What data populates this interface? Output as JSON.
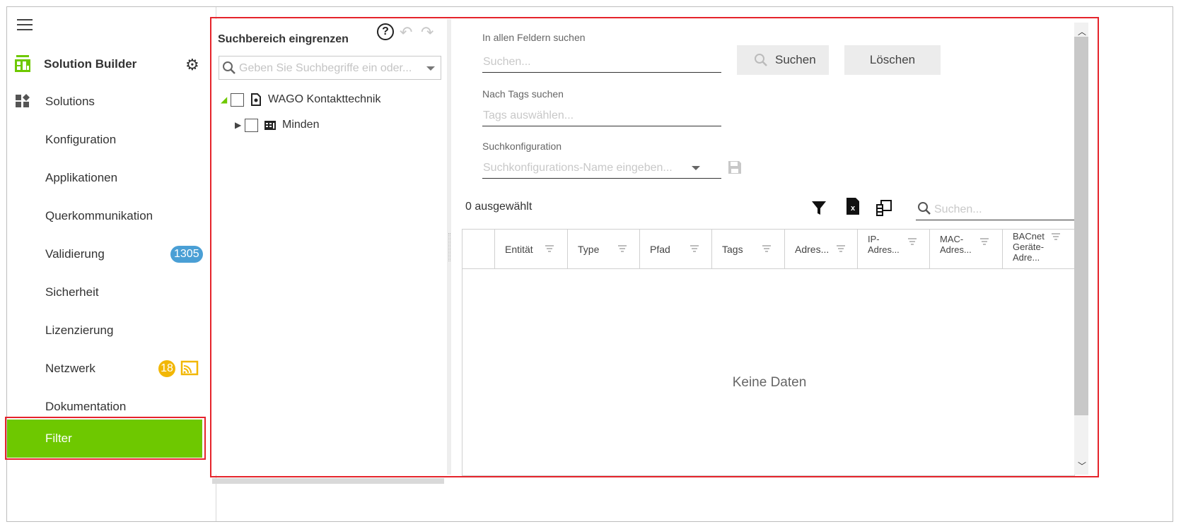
{
  "sidebar": {
    "app_title": "Solution Builder",
    "items": [
      {
        "label": "Solutions"
      },
      {
        "label": "Konfiguration"
      },
      {
        "label": "Applikationen"
      },
      {
        "label": "Querkommunikation"
      },
      {
        "label": "Validierung",
        "badge": "1305"
      },
      {
        "label": "Sicherheit"
      },
      {
        "label": "Lizenzierung"
      },
      {
        "label": "Netzwerk",
        "badge": "18"
      },
      {
        "label": "Dokumentation"
      },
      {
        "label": "Filter"
      }
    ],
    "active_color": "#6ec800"
  },
  "tree": {
    "title": "Suchbereich eingrenzen",
    "search_placeholder": "Geben Sie Suchbegriffe ein oder...",
    "nodes": [
      {
        "label": "WAGO Kontakttechnik"
      },
      {
        "label": "Minden"
      }
    ]
  },
  "search": {
    "all_fields_label": "In allen Feldern suchen",
    "all_fields_placeholder": "Suchen...",
    "search_button": "Suchen",
    "clear_button": "Löschen",
    "tags_label": "Nach Tags suchen",
    "tags_placeholder": "Tags auswählen...",
    "config_label": "Suchkonfiguration",
    "config_placeholder": "Suchkonfigurations-Name eingeben..."
  },
  "grid": {
    "selected_count": "0 ausgewählt",
    "search_placeholder": "Suchen...",
    "columns": [
      "Entität",
      "Type",
      "Pfad",
      "Tags",
      "Adres...",
      "IP-Adres...",
      "MAC-Adres...",
      "BACnet Geräte-Adre..."
    ],
    "empty_text": "Keine Daten"
  },
  "colors": {
    "highlight_outline": "#e5242b",
    "badge_blue": "#4a9fd5",
    "badge_yellow": "#f2b705"
  }
}
